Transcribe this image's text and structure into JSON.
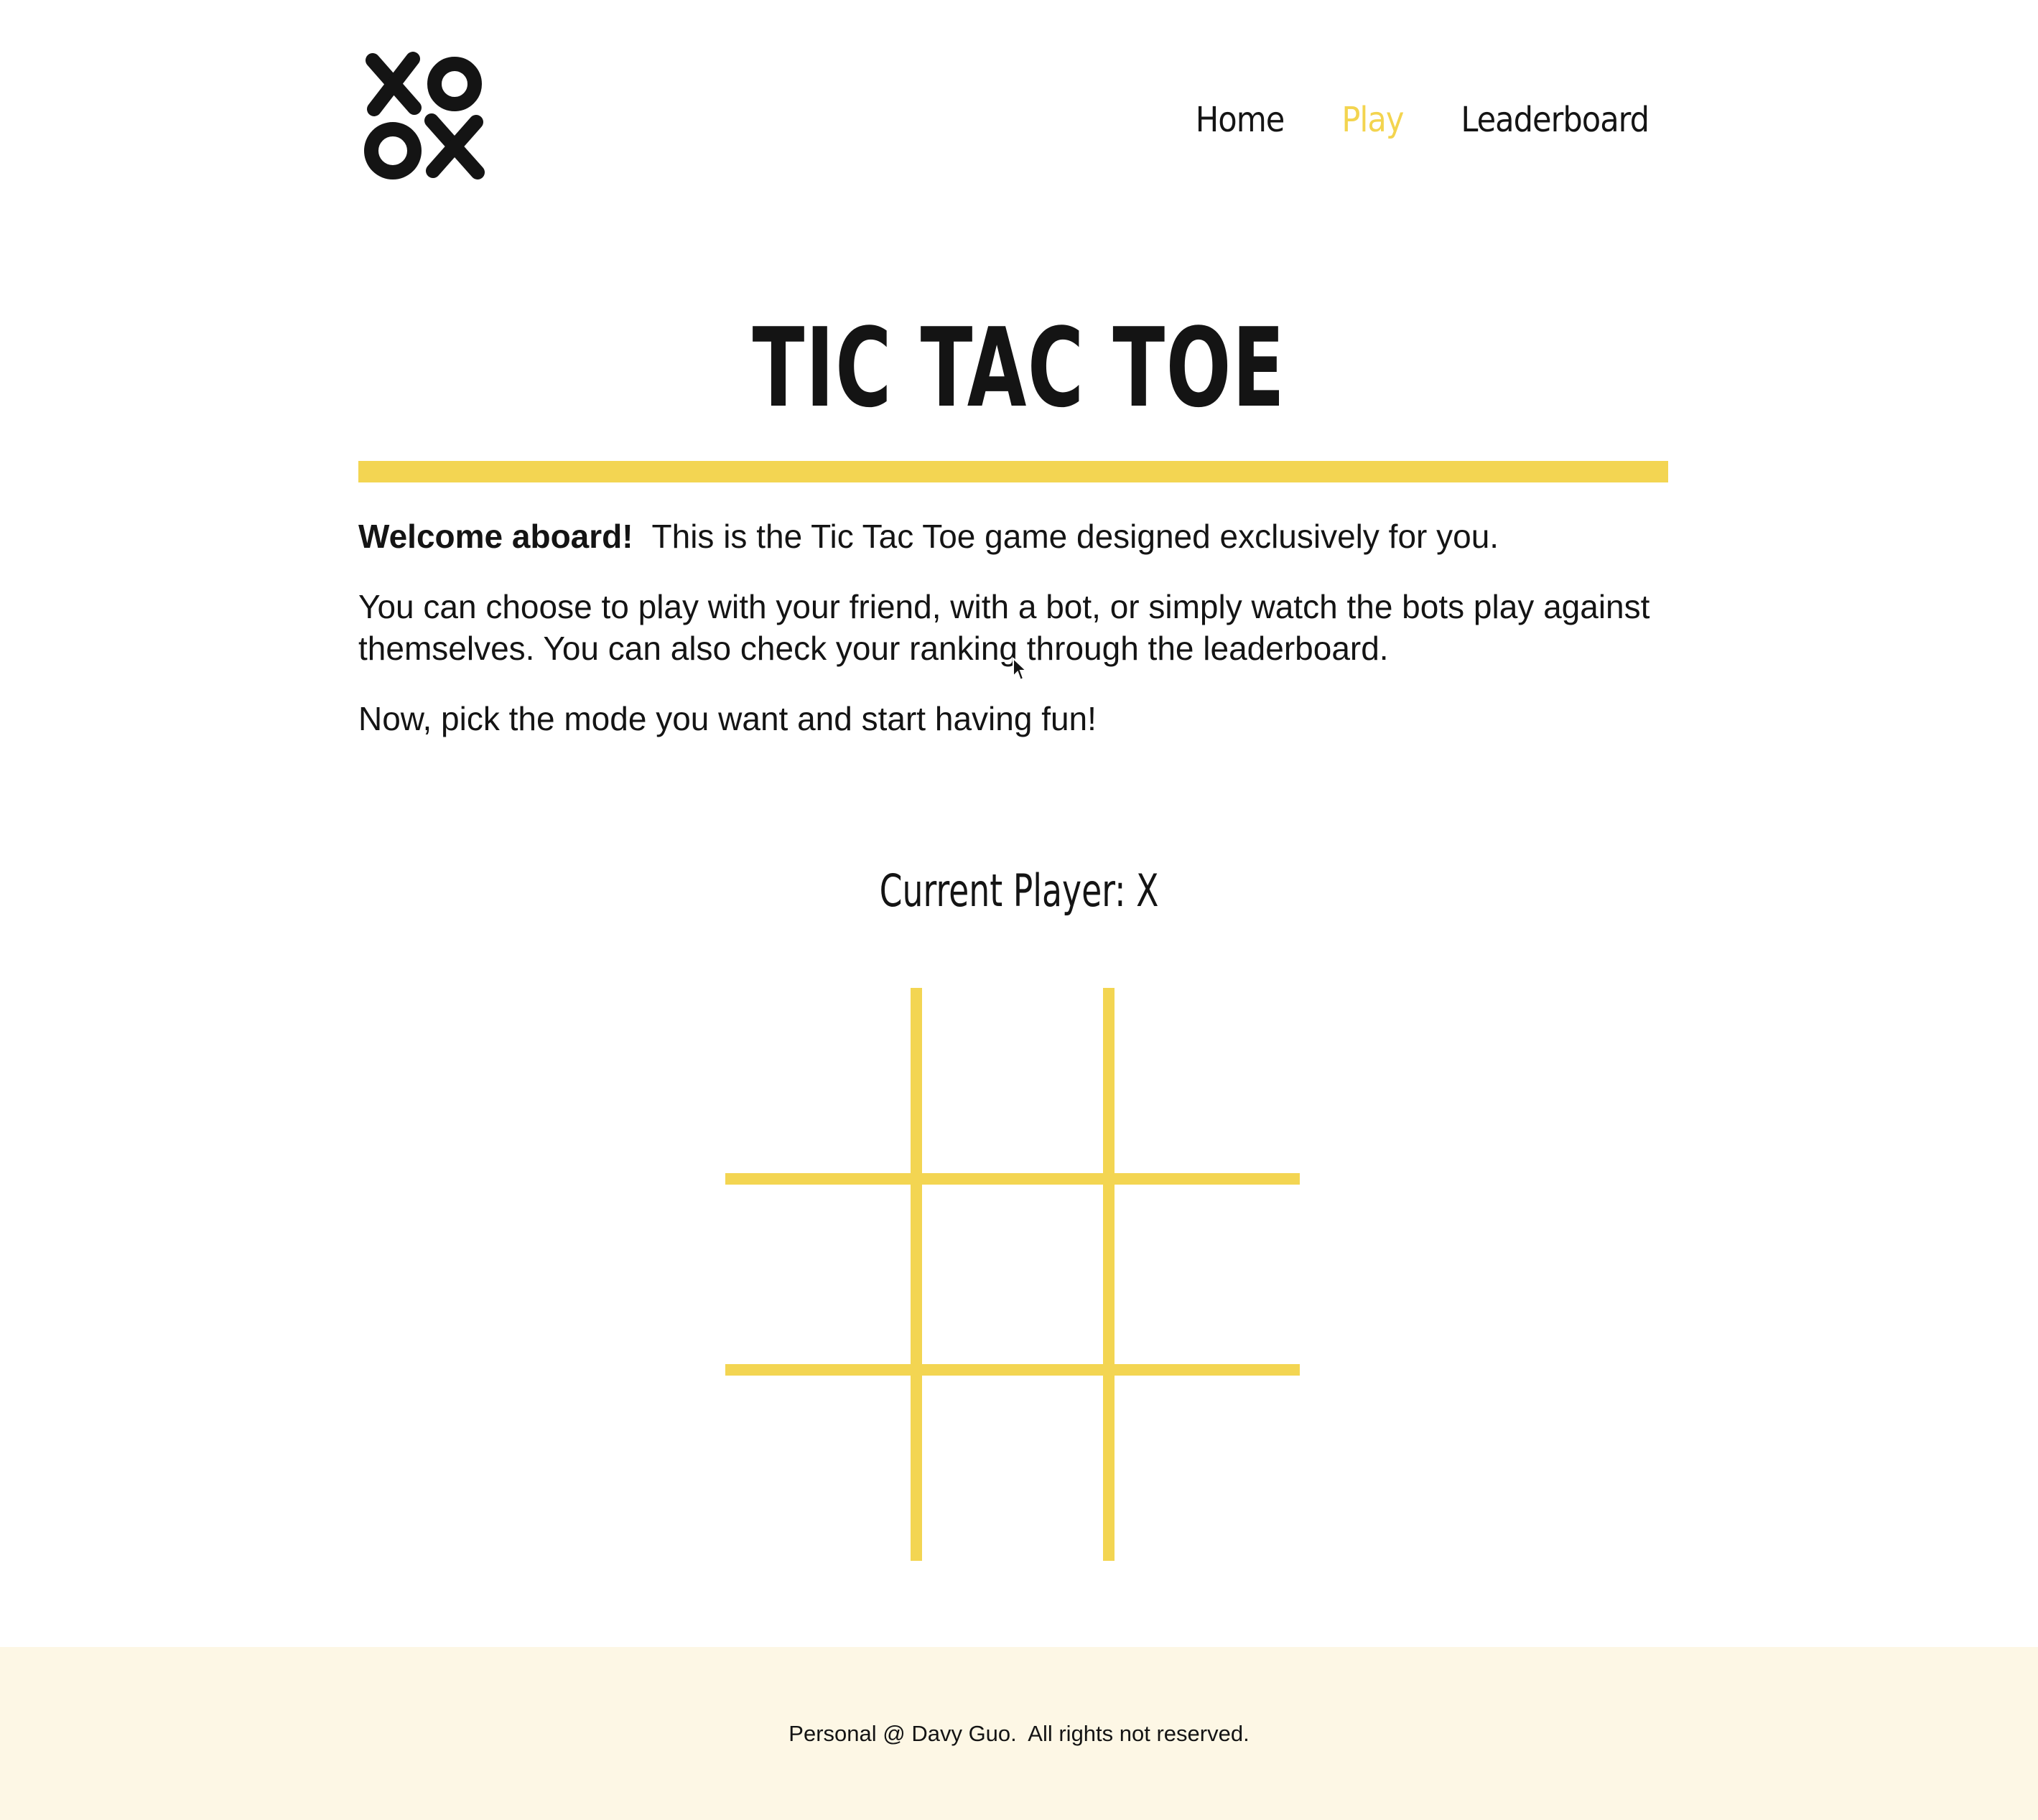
{
  "header": {
    "logo_icon": "xo-logo-icon",
    "nav": [
      {
        "label": "Home",
        "active": false
      },
      {
        "label": "Play",
        "active": true
      },
      {
        "label": "Leaderboard",
        "active": false
      }
    ]
  },
  "main": {
    "title": "TIC TAC TOE",
    "intro": {
      "welcome_bold": "Welcome aboard!",
      "welcome_rest": "This is the Tic Tac Toe game designed exclusively for you.",
      "paragraph2": "You can choose to play with your friend, with a bot, or simply watch the bots play against themselves. You can also check your ranking through the leaderboard.",
      "paragraph3": "Now, pick the mode you want and start having fun!"
    },
    "current_player_label": "Current Player: X"
  },
  "board": {
    "cells": [
      "",
      "",
      "",
      "",
      "",
      "",
      "",
      "",
      ""
    ]
  },
  "footer": {
    "text": "Personal @ Davy Guo.  All rights not reserved."
  },
  "colors": {
    "accent": "#f3d552",
    "nav_active": "#f3d44f",
    "text": "#141414",
    "footer_bg": "#fdf7e5"
  }
}
